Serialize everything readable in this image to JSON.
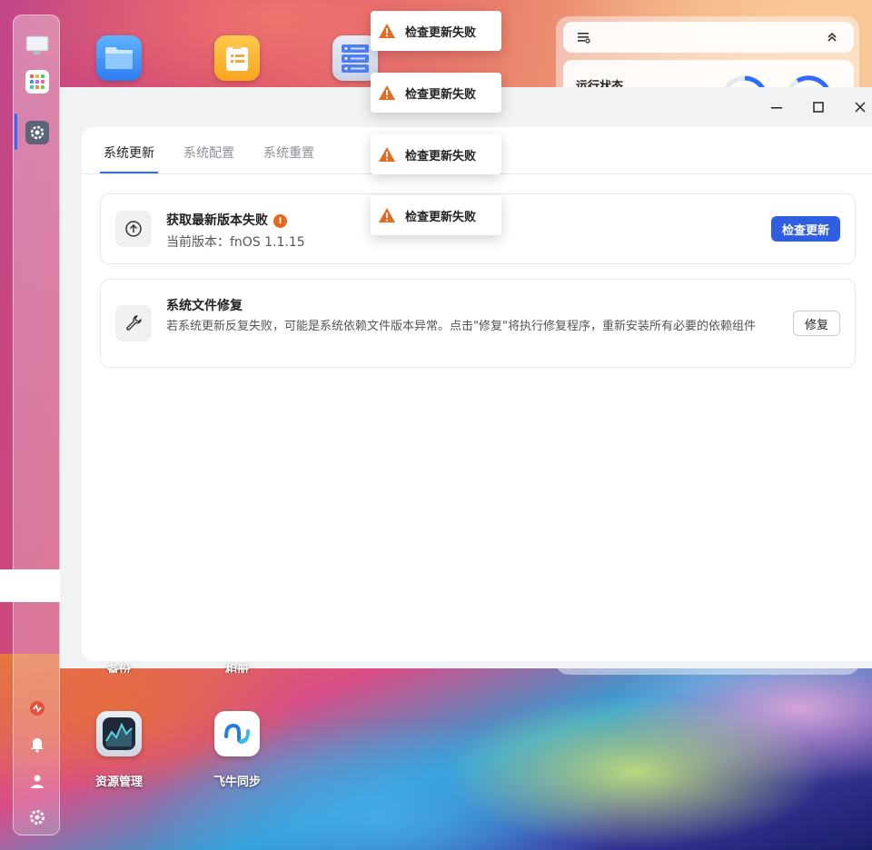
{
  "desktop": {
    "icons_bottom": [
      {
        "label": "资源管理"
      },
      {
        "label": "飞牛同步"
      }
    ],
    "partial_labels": [
      "备份",
      "相册"
    ]
  },
  "widget": {
    "status_title": "运行状态"
  },
  "window": {
    "tabs": [
      {
        "label": "系统更新",
        "active": true
      },
      {
        "label": "系统配置",
        "active": false
      },
      {
        "label": "系统重置",
        "active": false
      }
    ],
    "update_card": {
      "title": "获取最新版本失败",
      "badge": "!",
      "subtitle": "当前版本：fnOS 1.1.15",
      "button": "检查更新"
    },
    "repair_card": {
      "title": "系统文件修复",
      "description": "若系统更新反复失败，可能是系统依赖文件版本异常。点击\"修复\"将执行修复程序，重新安装所有必要的依赖组件",
      "button": "修复"
    }
  },
  "toasts": [
    {
      "text": "检查更新失败"
    },
    {
      "text": "检查更新失败"
    },
    {
      "text": "检查更新失败"
    },
    {
      "text": "检查更新失败"
    }
  ],
  "colors": {
    "accent": "#2f5fe0",
    "warning": "#e5691e",
    "tab_underline": "#2f6bff"
  }
}
